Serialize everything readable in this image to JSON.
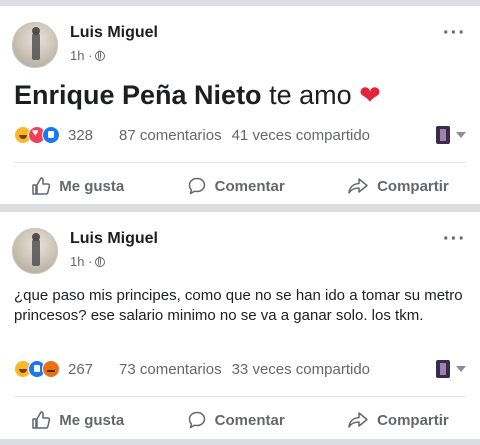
{
  "posts": [
    {
      "author": "Luis Miguel",
      "time": "1h ·",
      "text_bold": "Enrique Peña Nieto",
      "text_rest": " te amo ",
      "text_emoji": "❤",
      "reaction_count": "328",
      "comments": "87 comentarios",
      "shares": "41 veces compartido",
      "reaction_types": [
        "haha",
        "love",
        "like"
      ]
    },
    {
      "author": "Luis Miguel",
      "time": "1h ·",
      "text": "¿que paso mis principes, como que no se han ido a tomar su metro princesos? ese salario minimo no se va a ganar solo. los tkm.",
      "reaction_count": "267",
      "comments": "73 comentarios",
      "shares": "33 veces compartido",
      "reaction_types": [
        "haha",
        "like",
        "angry"
      ]
    }
  ],
  "actions": {
    "like": "Me gusta",
    "comment": "Comentar",
    "share": "Compartir"
  },
  "icons": {
    "more": "more-options-icon",
    "privacy": "globe-icon",
    "like": "thumbs-up-icon",
    "comment": "comment-bubble-icon",
    "share": "share-arrow-icon"
  },
  "colors": {
    "background": "#dadde1",
    "card": "#ffffff",
    "text": "#1c1e21",
    "muted": "#65676b",
    "heart": "#e4243b"
  }
}
